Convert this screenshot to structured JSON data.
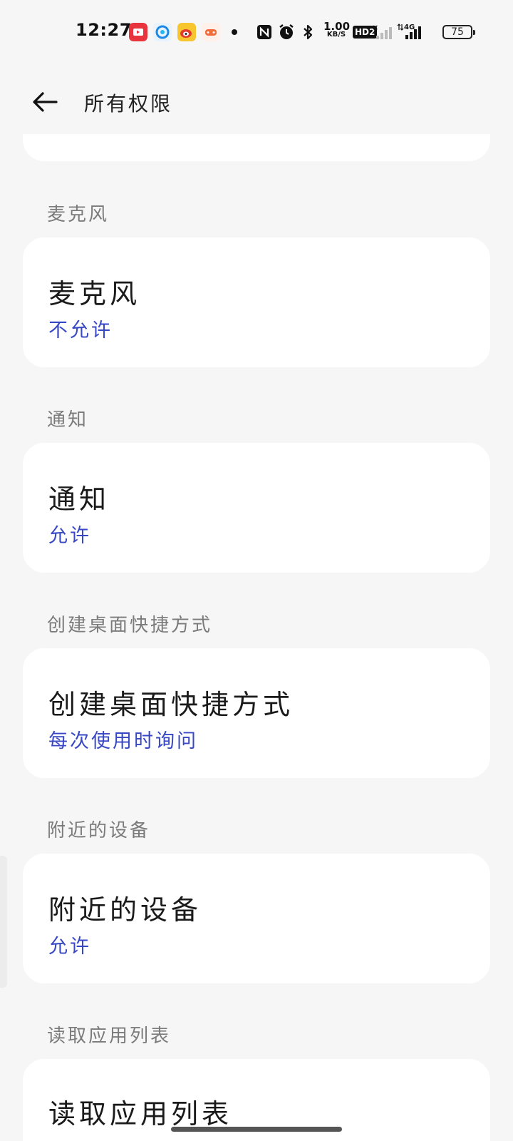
{
  "status_bar": {
    "time": "12:27",
    "net_speed_value": "1.00",
    "net_speed_unit": "KB/S",
    "hd_badge": "HD2",
    "network_type": "4G",
    "battery_level": "75"
  },
  "header": {
    "title": "所有权限"
  },
  "sections": [
    {
      "label": "麦克风",
      "title": "麦克风",
      "value": "不允许"
    },
    {
      "label": "通知",
      "title": "通知",
      "value": "允许"
    },
    {
      "label": "创建桌面快捷方式",
      "title": "创建桌面快捷方式",
      "value": "每次使用时询问"
    },
    {
      "label": "附近的设备",
      "title": "附近的设备",
      "value": "允许"
    },
    {
      "label": "读取应用列表",
      "title": "读取应用列表",
      "value": ""
    }
  ],
  "colors": {
    "background": "#f6f6f6",
    "card": "#ffffff",
    "value_blue": "#3848c4",
    "section_label": "#7b7b7b"
  }
}
